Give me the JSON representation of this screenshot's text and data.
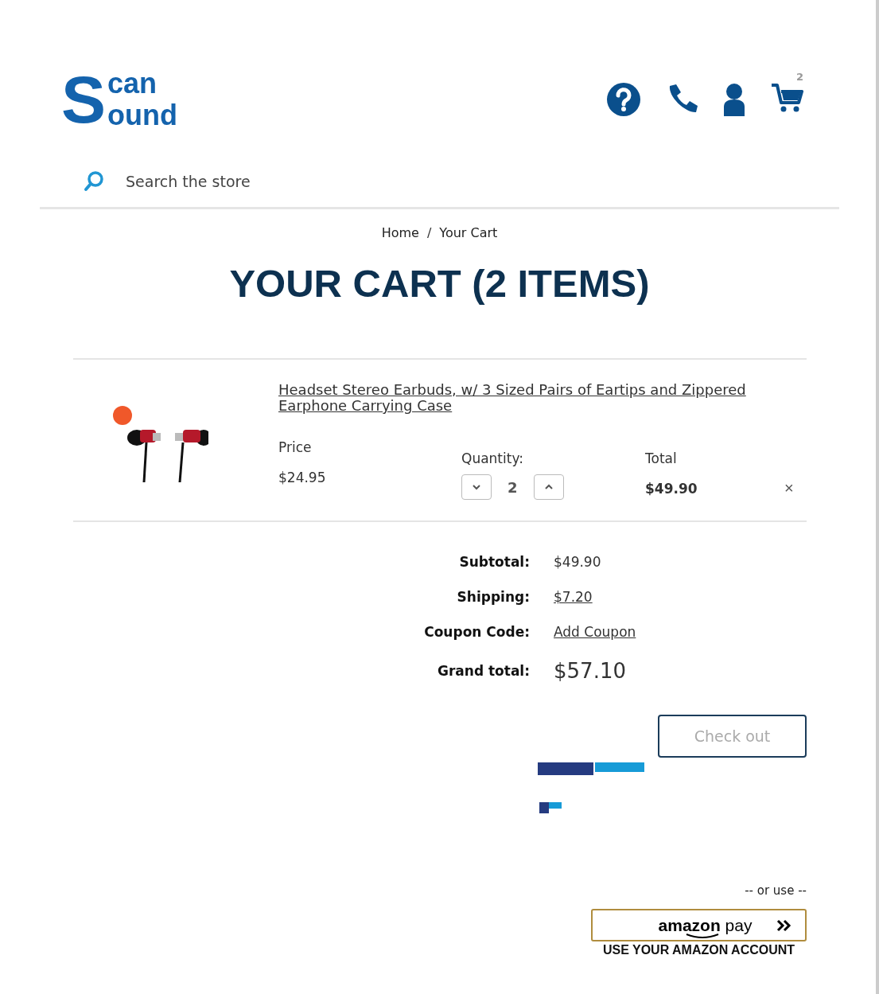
{
  "logo": {
    "initial": "S",
    "top": "can",
    "bottom": "ound"
  },
  "header": {
    "cart_count": "2"
  },
  "search": {
    "placeholder": "Search the store"
  },
  "breadcrumbs": [
    {
      "label": "Home"
    },
    {
      "label": "Your Cart"
    }
  ],
  "breadcrumb_separator": "/",
  "title": "YOUR CART (2 ITEMS)",
  "items": [
    {
      "name": "Headset Stereo Earbuds, w/ 3 Sized Pairs of Eartips and Zippered Earphone Carrying Case",
      "price_label": "Price",
      "price": "$24.95",
      "quantity_label": "Quantity:",
      "quantity": "2",
      "total_label": "Total",
      "total": "$49.90",
      "remove": "×"
    }
  ],
  "totals": [
    {
      "label": "Subtotal:",
      "value": "$49.90",
      "kind": "plain"
    },
    {
      "label": "Shipping:",
      "value": "$7.20",
      "kind": "link"
    },
    {
      "label": "Coupon Code:",
      "value": "Add Coupon",
      "kind": "link"
    },
    {
      "label": "Grand total:",
      "value": "$57.10",
      "kind": "grand"
    }
  ],
  "checkout_button": "Check out",
  "or_use": "-- or use --",
  "amazon": {
    "brand": "amazon",
    "pay": "pay",
    "caption": "USE YOUR AMAZON ACCOUNT"
  }
}
